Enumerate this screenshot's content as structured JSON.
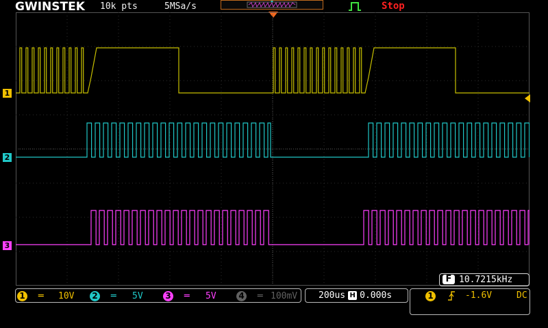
{
  "header": {
    "brand": "GWINSTEK",
    "record_length": "10k pts",
    "sample_rate": "5MSa/s",
    "run_state": "Stop"
  },
  "colors": {
    "ch1": "#c8c000",
    "ch2": "#20c8c8",
    "ch3": "#ff40ff",
    "ch4": "#606060",
    "grid": "#2e2e2e",
    "trigger_marker": "#ff6a1a",
    "stop": "#ff2020"
  },
  "channels": [
    {
      "num": "1",
      "coupling": "DC",
      "scale": "10V",
      "marker": "1"
    },
    {
      "num": "2",
      "coupling": "DC",
      "scale": "5V",
      "marker": "2"
    },
    {
      "num": "3",
      "coupling": "DC",
      "scale": "5V",
      "marker": "3"
    },
    {
      "num": "4",
      "coupling": "DC",
      "scale": "100mV",
      "enabled": false
    }
  ],
  "timebase": {
    "scale": "200us",
    "position": "0.000s",
    "icon": "H"
  },
  "frequency": {
    "icon": "F",
    "value": "10.7215kHz"
  },
  "trigger": {
    "source": "1",
    "slope_icon": "rising-edge-icon",
    "level": "-1.6V",
    "coupling": "DC"
  },
  "icons": [
    "trigger-pointer-icon",
    "trigger-status-icon",
    "memory-bar-icon"
  ]
}
